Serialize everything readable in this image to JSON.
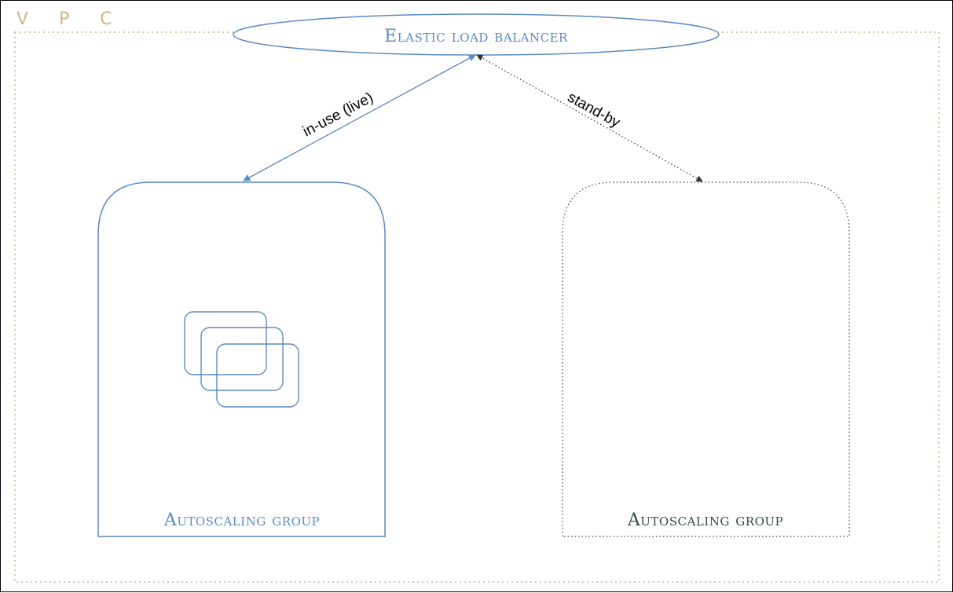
{
  "vpc": {
    "label": "V P C",
    "border_color": "#c9b98a"
  },
  "load_balancer": {
    "label": "Elastic load balancer",
    "color": "#5b8ac4"
  },
  "connections": {
    "live_label": "in-use (live)",
    "standby_label": "stand-by"
  },
  "groups": {
    "live": {
      "label": "Autoscaling group",
      "color": "#5b8ac4"
    },
    "standby": {
      "label": "Autoscaling group",
      "color": "#2f4f3f"
    }
  }
}
